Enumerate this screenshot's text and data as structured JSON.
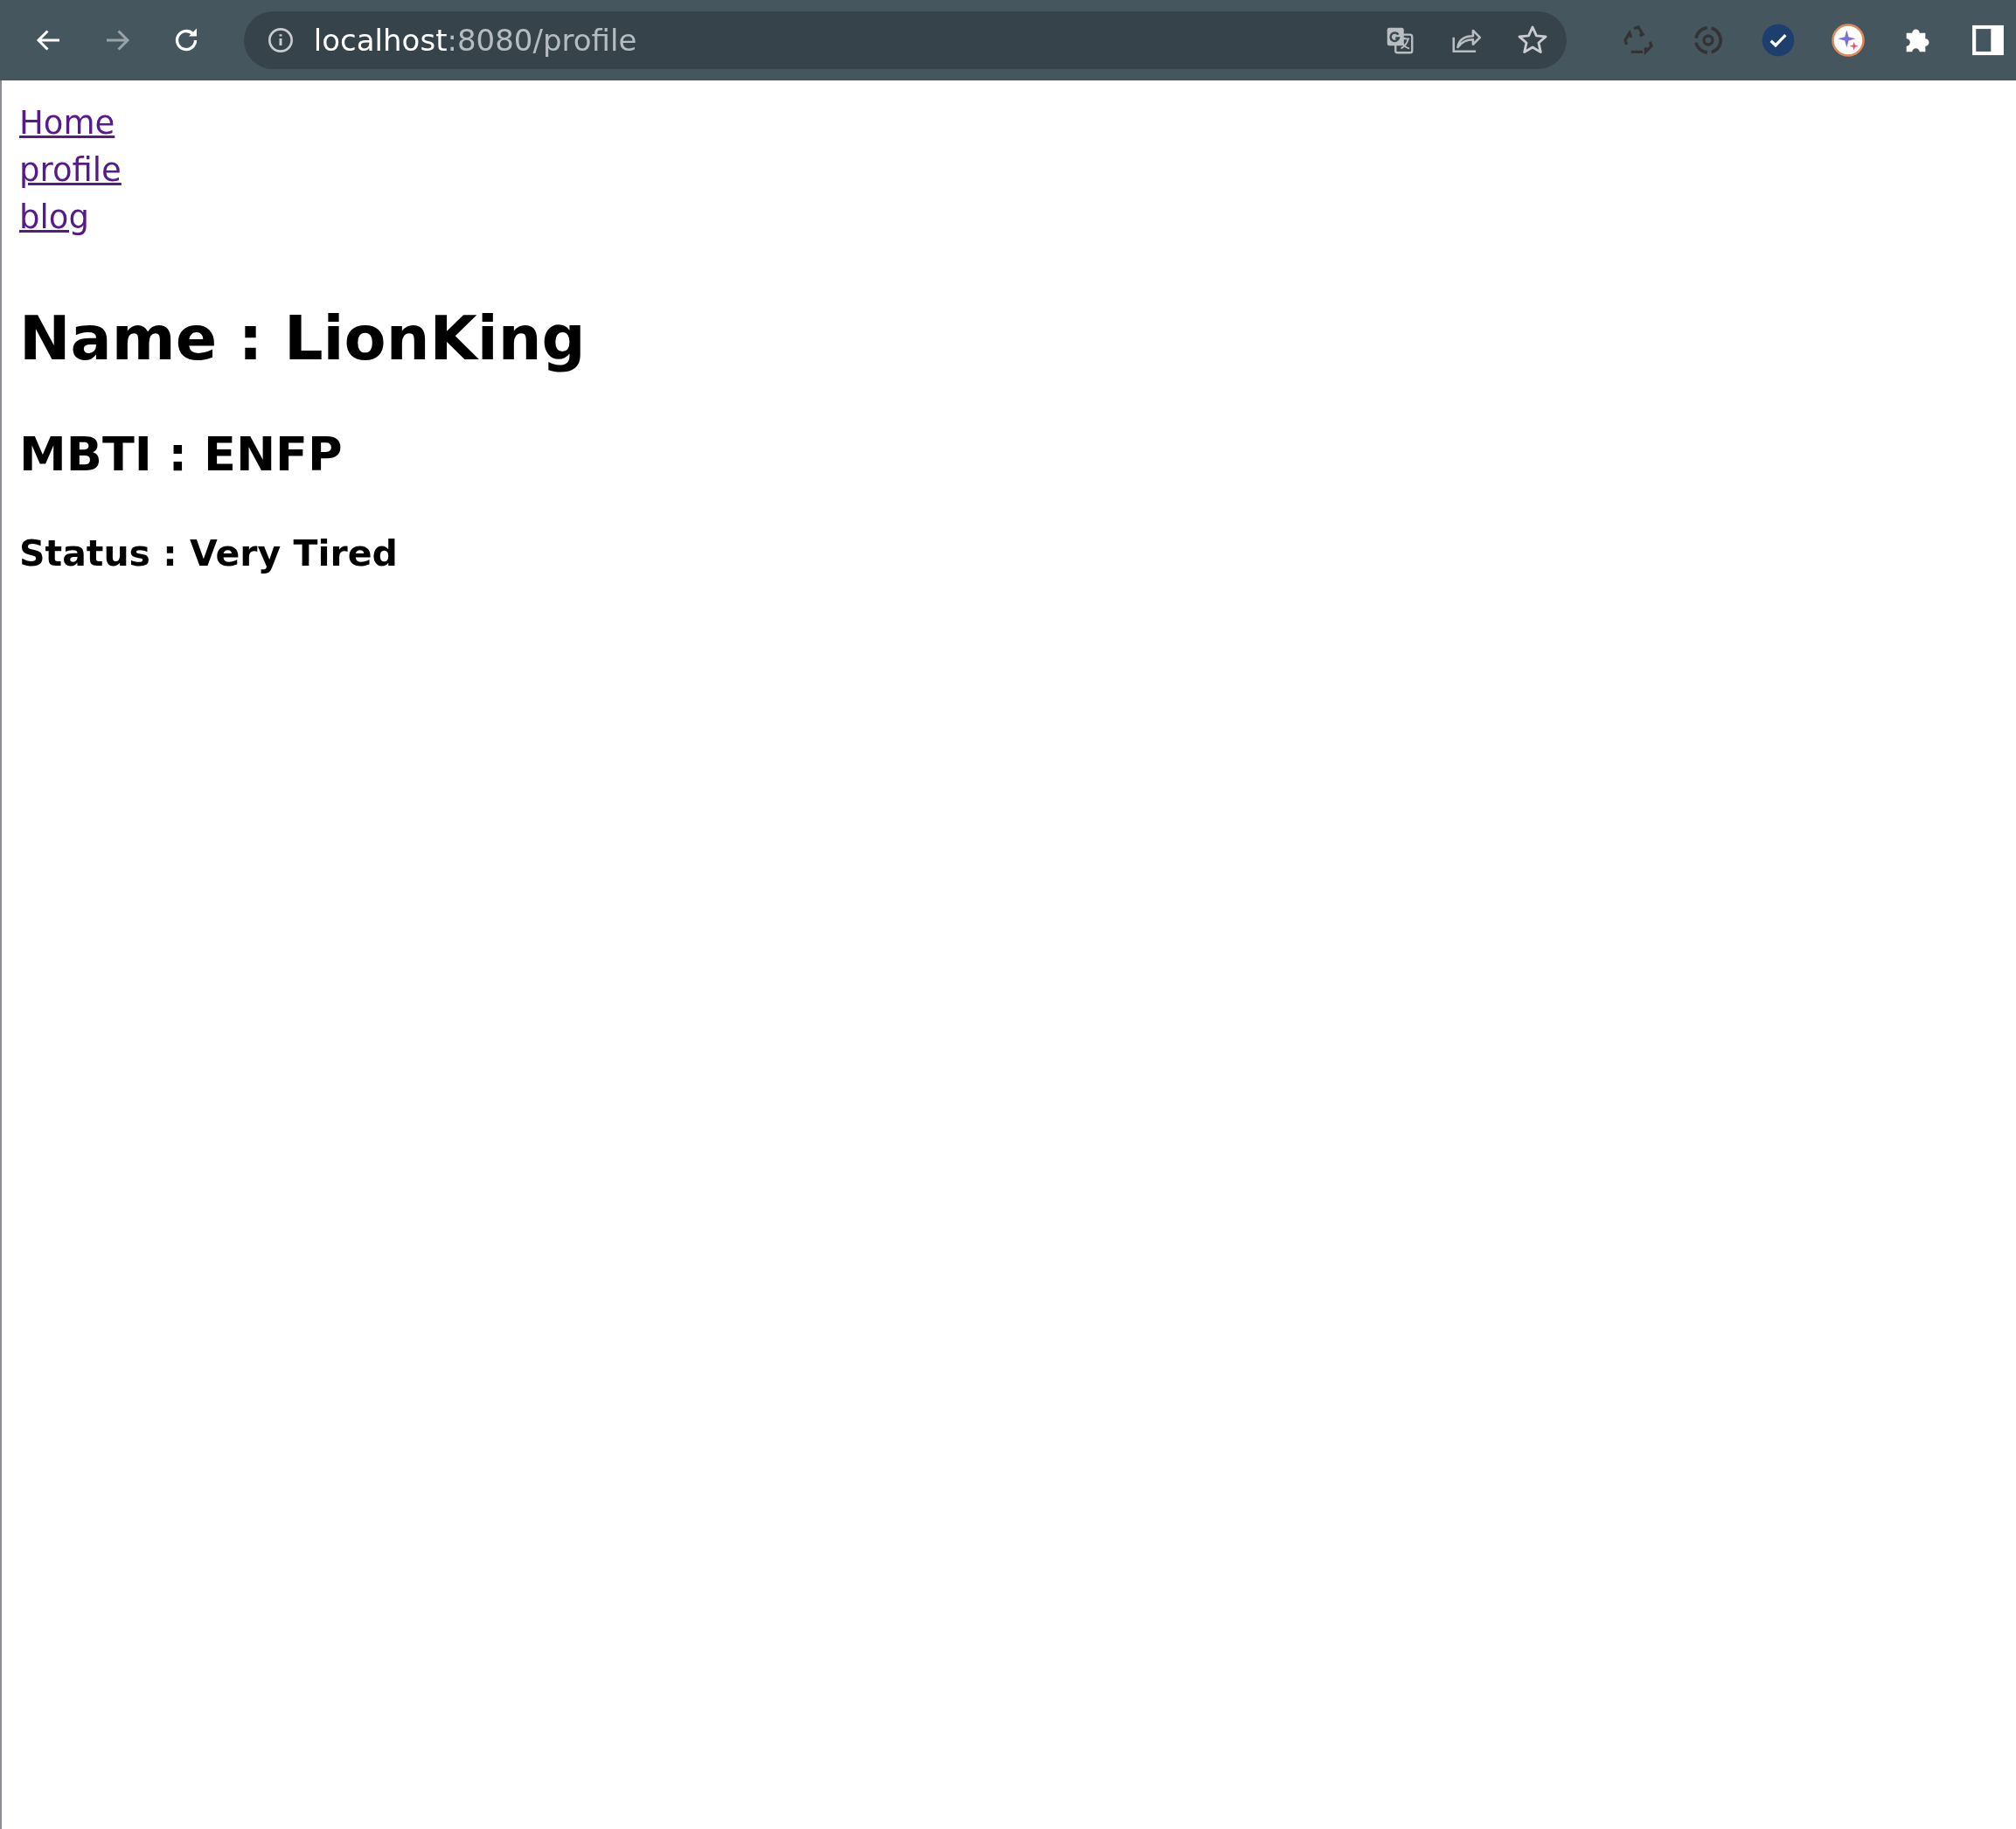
{
  "browser": {
    "nav_buttons": [
      {
        "kind": "back",
        "disabled": false
      },
      {
        "kind": "forward",
        "disabled": true
      },
      {
        "kind": "reload",
        "disabled": false
      }
    ],
    "address": {
      "host": "localhost",
      "path": ":8080/profile"
    },
    "address_actions": [
      {
        "kind": "translate"
      },
      {
        "kind": "share"
      },
      {
        "kind": "star"
      }
    ],
    "extensions": [
      {
        "kind": "recycle",
        "disabled": true
      },
      {
        "kind": "rotate",
        "disabled": true
      },
      {
        "kind": "check",
        "disabled": false
      },
      {
        "kind": "sparkle",
        "disabled": false
      },
      {
        "kind": "puzzle",
        "disabled": false
      },
      {
        "kind": "sidepanel",
        "disabled": false
      }
    ]
  },
  "nav_links": [
    "Home",
    "profile",
    "blog"
  ],
  "name_heading": "Name : LionKing",
  "mbti_heading": "MBTI : ENFP",
  "status_heading": "Status : Very Tired"
}
